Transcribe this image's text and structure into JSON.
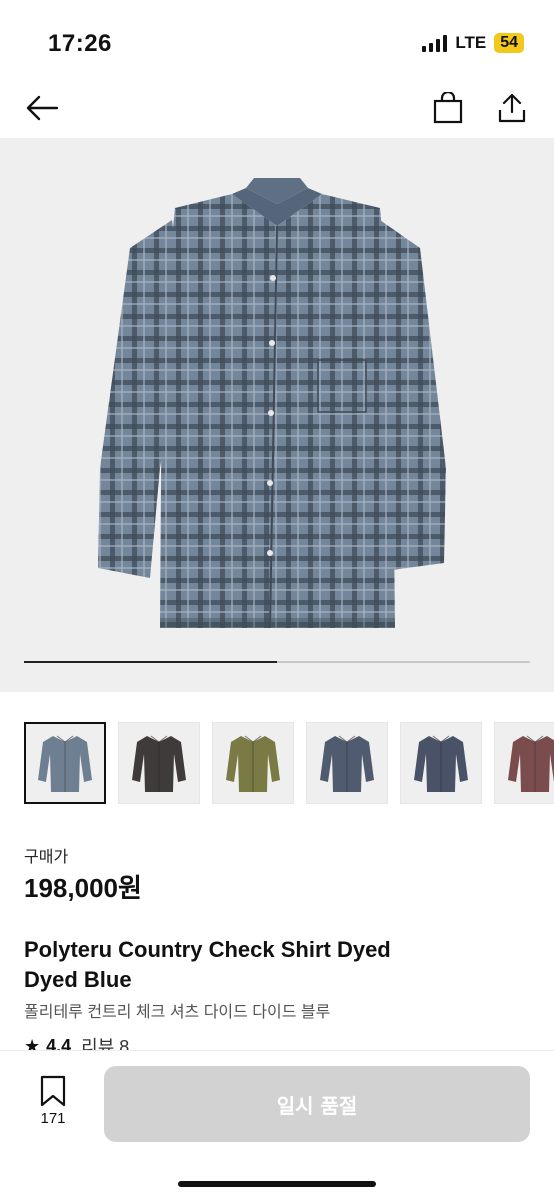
{
  "status_bar": {
    "time": "17:26",
    "network": "LTE",
    "battery": "54"
  },
  "nav": {
    "back_icon": "arrow-left-icon",
    "bag_icon": "shopping-bag-icon",
    "share_icon": "share-icon"
  },
  "gallery": {
    "progress": 0.5,
    "thumbnails": [
      {
        "color": "#6f7f92",
        "selected": true
      },
      {
        "color": "#3e3b3a"
      },
      {
        "color": "#7a7a45"
      },
      {
        "color": "#505b70"
      },
      {
        "color": "#4a5268"
      },
      {
        "color": "#7a4c4e"
      }
    ]
  },
  "product": {
    "price_label": "구매가",
    "price": "198,000원",
    "title_line1": "Polyteru Country Check Shirt Dyed",
    "title_line2": "Dyed Blue",
    "title_ko": "폴리테루 컨트리 체크 셔츠 다이드 다이드 블루",
    "rating": "4.4",
    "review_label": "리뷰 8"
  },
  "bottom": {
    "wishlist_count": "171",
    "buy_label": "일시 품절"
  },
  "colors": {
    "button_disabled": "#d2d2d2",
    "battery": "#f2c81b"
  }
}
